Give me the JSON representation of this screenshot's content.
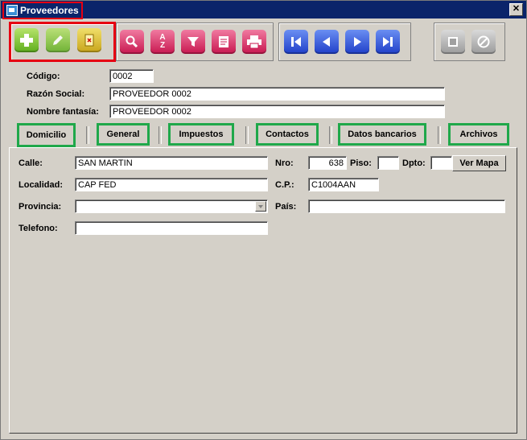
{
  "window": {
    "title": "Proveedores",
    "close_symbol": "✕"
  },
  "toolbar": {
    "edit_group": [
      {
        "name": "add-button",
        "icon": "plus-icon",
        "color": "#7cc242"
      },
      {
        "name": "edit-button",
        "icon": "pencil-icon",
        "color": "#9ed05a"
      },
      {
        "name": "delete-button",
        "icon": "document-x-icon",
        "color": "#d8bb2a"
      }
    ],
    "tools_group": [
      {
        "name": "search-button",
        "icon": "magnifier-icon"
      },
      {
        "name": "sort-button",
        "icon": "sort-az-icon",
        "sort_top": "A",
        "sort_bottom": "Z"
      },
      {
        "name": "filter-button",
        "icon": "funnel-icon"
      },
      {
        "name": "report-button",
        "icon": "clipboard-icon"
      },
      {
        "name": "print-button",
        "icon": "printer-icon"
      }
    ],
    "nav_group": [
      {
        "name": "first-record-button",
        "icon": "first-icon"
      },
      {
        "name": "prev-record-button",
        "icon": "prev-icon"
      },
      {
        "name": "next-record-button",
        "icon": "next-icon"
      },
      {
        "name": "last-record-button",
        "icon": "last-icon"
      }
    ],
    "save_group": [
      {
        "name": "save-button",
        "icon": "save-icon"
      },
      {
        "name": "cancel-button",
        "icon": "cancel-icon"
      }
    ]
  },
  "header": {
    "codigo_label": "Código:",
    "codigo_value": "0002",
    "razon_label": "Razón Social:",
    "razon_value": "PROVEEDOR 0002",
    "fantasia_label": "Nombre fantasía:",
    "fantasia_value": "PROVEEDOR 0002"
  },
  "tabs": [
    "Domicilio",
    "General",
    "Impuestos",
    "Contactos",
    "Datos bancarios",
    "Archivos"
  ],
  "domicilio": {
    "calle_label": "Calle:",
    "calle_value": "SAN MARTIN",
    "nro_label": "Nro:",
    "nro_value": "638",
    "piso_label": "Piso:",
    "piso_value": "",
    "dpto_label": "Dpto:",
    "dpto_value": "",
    "ver_mapa": "Ver Mapa",
    "localidad_label": "Localidad:",
    "localidad_value": "CAP FED",
    "cp_label": "C.P.:",
    "cp_value": "C1004AAN",
    "provincia_label": "Provincia:",
    "provincia_value": "",
    "pais_label": "País:",
    "pais_value": "",
    "telefono_label": "Telefono:",
    "telefono_value": ""
  },
  "colors": {
    "highlight_red": "#e60012",
    "highlight_green": "#1fa84a",
    "titlebar": "#0a246a"
  }
}
